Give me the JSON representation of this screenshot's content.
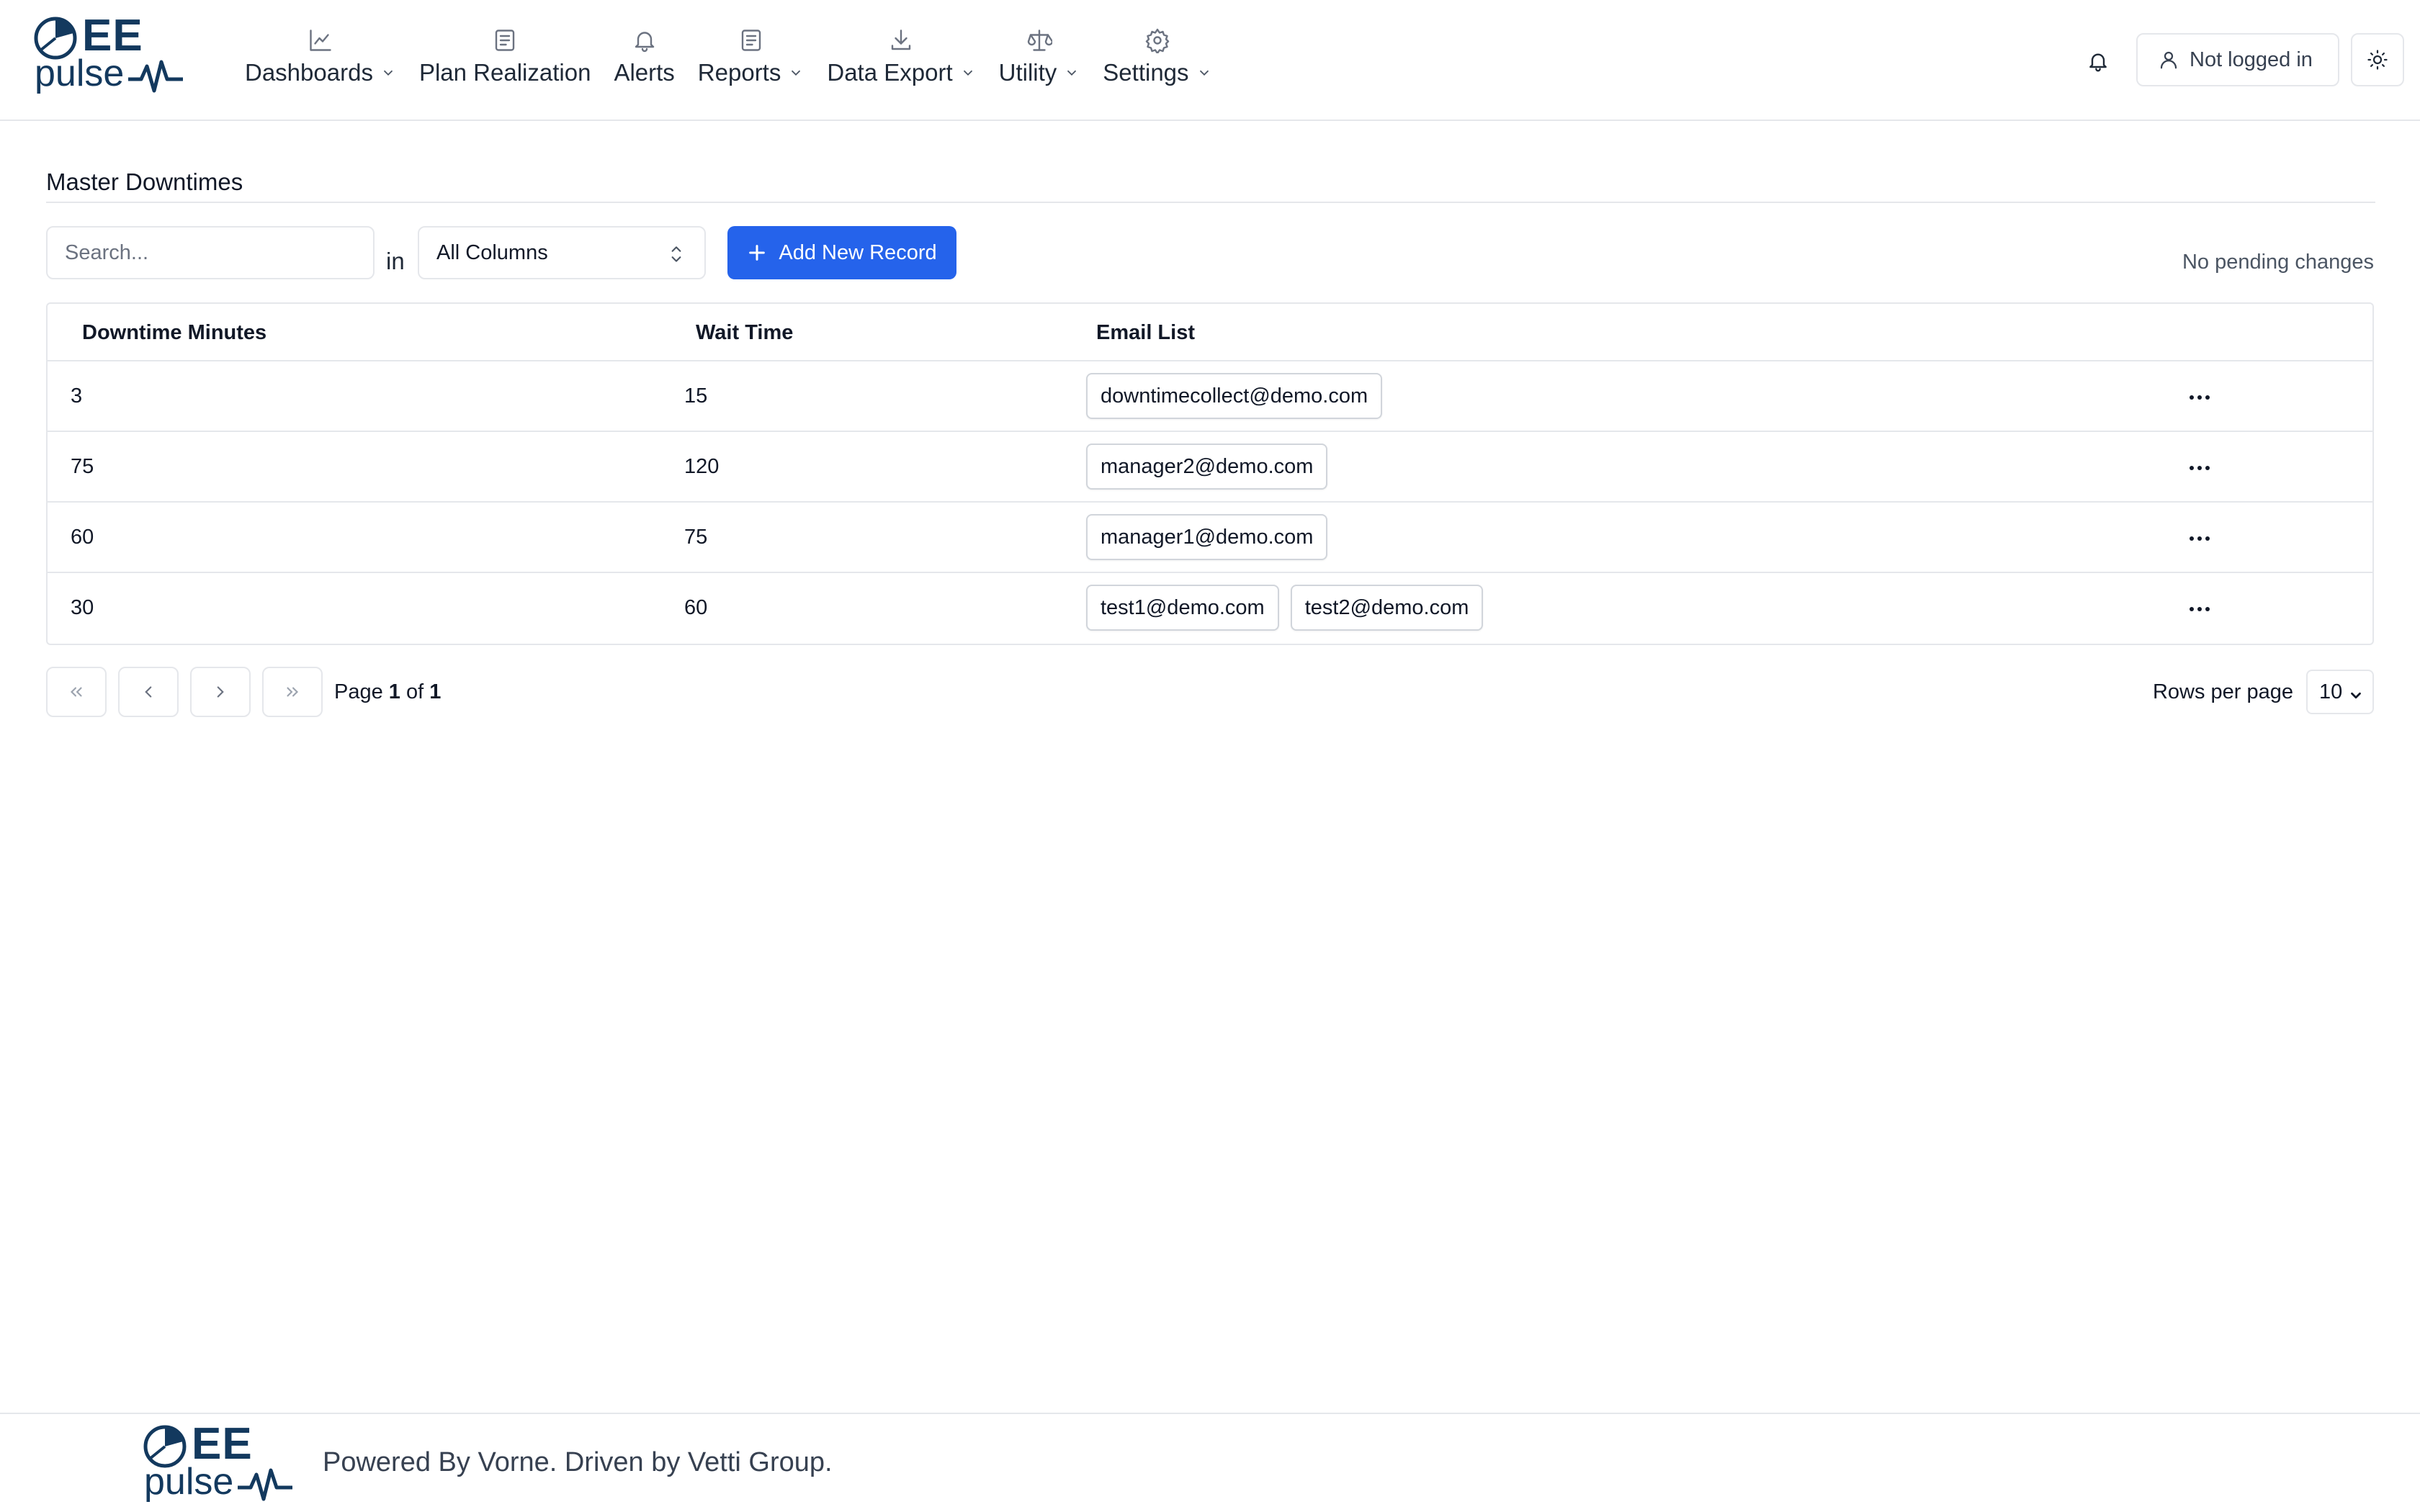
{
  "logo": {
    "top_text": "EE",
    "bottom_text": "pulse",
    "brand_color": "#13395e"
  },
  "nav": [
    {
      "label": "Dashboards",
      "icon": "chart-line-icon",
      "has_dropdown": true
    },
    {
      "label": "Plan Realization",
      "icon": "document-icon",
      "has_dropdown": false
    },
    {
      "label": "Alerts",
      "icon": "bell-icon",
      "has_dropdown": false
    },
    {
      "label": "Reports",
      "icon": "document-icon",
      "has_dropdown": true
    },
    {
      "label": "Data Export",
      "icon": "download-icon",
      "has_dropdown": true
    },
    {
      "label": "Utility",
      "icon": "scale-icon",
      "has_dropdown": true
    },
    {
      "label": "Settings",
      "icon": "gear-icon",
      "has_dropdown": true
    }
  ],
  "header": {
    "user_label": "Not logged in"
  },
  "page": {
    "title": "Master Downtimes"
  },
  "toolbar": {
    "search_placeholder": "Search...",
    "in_label": "in",
    "column_select_value": "All Columns",
    "add_label": "Add New Record",
    "pending_text": "No pending changes",
    "accent_color": "#2563eb"
  },
  "table": {
    "columns": [
      "Downtime Minutes",
      "Wait Time",
      "Email List"
    ],
    "rows": [
      {
        "downtime": "3",
        "wait": "15",
        "emails": [
          "downtimecollect@demo.com"
        ]
      },
      {
        "downtime": "75",
        "wait": "120",
        "emails": [
          "manager2@demo.com"
        ]
      },
      {
        "downtime": "60",
        "wait": "75",
        "emails": [
          "manager1@demo.com"
        ]
      },
      {
        "downtime": "30",
        "wait": "60",
        "emails": [
          "test1@demo.com",
          "test2@demo.com"
        ]
      }
    ]
  },
  "pagination": {
    "page_word": "Page",
    "current": "1",
    "of_word": "of",
    "total": "1",
    "rows_per_page_label": "Rows per page",
    "rows_per_page_value": "10"
  },
  "footer": {
    "text": "Powered By Vorne. Driven by Vetti Group."
  }
}
